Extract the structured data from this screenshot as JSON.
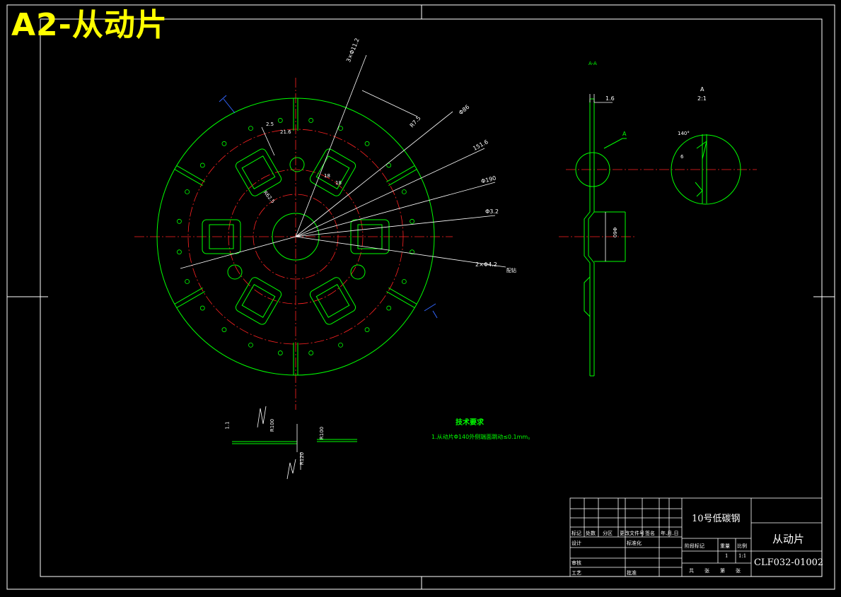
{
  "banner": {
    "title": "A2-从动片"
  },
  "tech_requirements": {
    "title": "技术要求",
    "items": [
      "1.从动片Φ140外侧端面跳动≤0.1mm。"
    ]
  },
  "dimensions": {
    "front_view": [
      "3×Φ11.2",
      "R7.5",
      "Φ86",
      "151.6",
      "Φ190",
      "Φ3.2",
      "2×Φ4.2",
      "21.6",
      "2.5",
      "18",
      "18",
      "R62.5",
      "配钻"
    ],
    "side_view": [
      "1.6",
      "A",
      "Φ60"
    ],
    "detail_view": [
      "A",
      "2:1",
      "140°",
      "6"
    ],
    "section_view": [
      "1.1",
      "R100",
      "R100",
      "R120"
    ],
    "section_mark": "A-A"
  },
  "title_block": {
    "material": "10号低碳钢",
    "part_name": "从动片",
    "drawing_no": "CLF032-01002",
    "weight": "1",
    "scale": "1:1",
    "header_labels": [
      "标记",
      "处数",
      "分区",
      "更改文件号",
      "签名",
      "年.月.日"
    ],
    "role_labels": [
      "设计",
      "标准化",
      "审核",
      "工艺",
      "批准"
    ],
    "stage_labels": [
      "阶段标记",
      "重量",
      "比例"
    ],
    "sheet_labels": [
      "共",
      "张",
      "第",
      "张"
    ]
  }
}
